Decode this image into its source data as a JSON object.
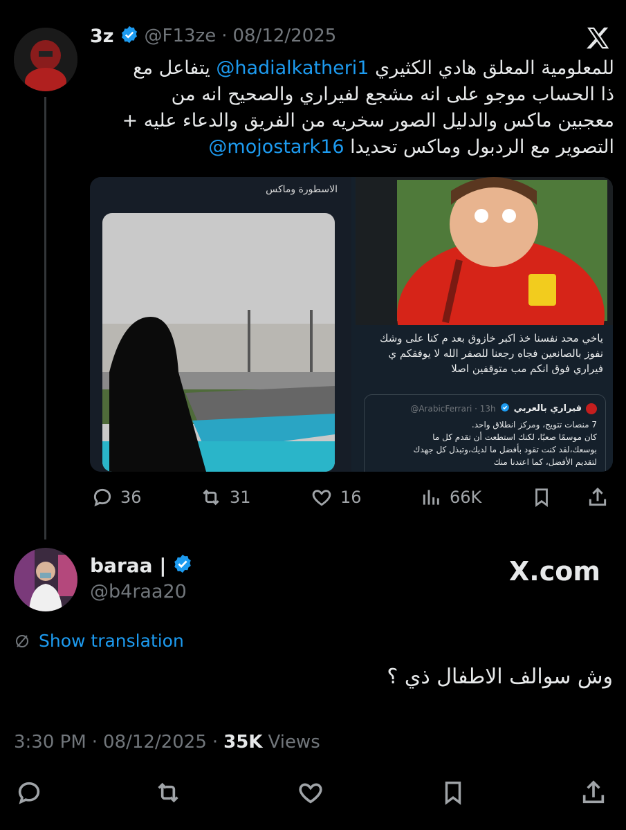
{
  "quoted_tweet": {
    "display_name": "3z",
    "handle": "@F13ze",
    "separator": "·",
    "date": "08/12/2025",
    "text_line1_prefix": "للمعلومية المعلق هادي الكثيري ",
    "mention1": "@hadialkatheri1",
    "text_line1_suffix": " يتفاعل مع",
    "text_line2": "ذا الحساب موجو على انه مشجع لفيراري والصحيح انه من",
    "text_line3": "معجبين ماكس والدليل الصور سخريه من الفريق والدعاء عليه +",
    "text_line4_prefix": "التصوير مع الردبول وماكس تحديدا ",
    "mention2": "@mojostark16",
    "media": {
      "left_panel_caption": "الاسطورة وماكس",
      "right_bottom_text": "ياخي محد نفسنا خذ اكبر خازوق بعد م كنا على وشك نفوز بالصانعين فجاه رجعنا للصفر الله لا يوفقكم ي فيراري فوق انكم مب متوقفين اصلا",
      "embedded_name": "فيراري بالعربي",
      "embedded_handle": "@ArabicFerrari · 13h",
      "embedded_line1": "7 منصات تتويج، ومركز انطلاق واحد.",
      "embedded_line2": "كان موسمًا صعبًا، لكنك استطعت أن تقدم كل ما",
      "embedded_line3": "بوسعك،لقد كنت تقود بأفضل ما لديك،وتبذل كل جهدك",
      "embedded_line4": "لتقديم الأفضل، كما اعتدنا منك"
    },
    "stats": {
      "replies": "36",
      "retweets": "31",
      "likes": "16",
      "views": "66K"
    }
  },
  "main_tweet": {
    "display_name": "baraa |",
    "handle": "@b4raa20",
    "watermark": "X.com",
    "translate_label": "Show translation",
    "text": "وش سوالف الاطفال ذي ؟",
    "time": "3:30 PM",
    "date": "08/12/2025",
    "separator": "·",
    "views_count": "35K",
    "views_label": "Views"
  },
  "icons": [
    "x-logo-icon",
    "verified-icon",
    "reply-icon",
    "retweet-icon",
    "like-icon",
    "views-icon",
    "bookmark-icon",
    "share-icon",
    "translate-icon"
  ],
  "colors": {
    "accent": "#1d9bf0",
    "background": "#000000",
    "muted": "#71767b",
    "text": "#e7e9ea"
  }
}
